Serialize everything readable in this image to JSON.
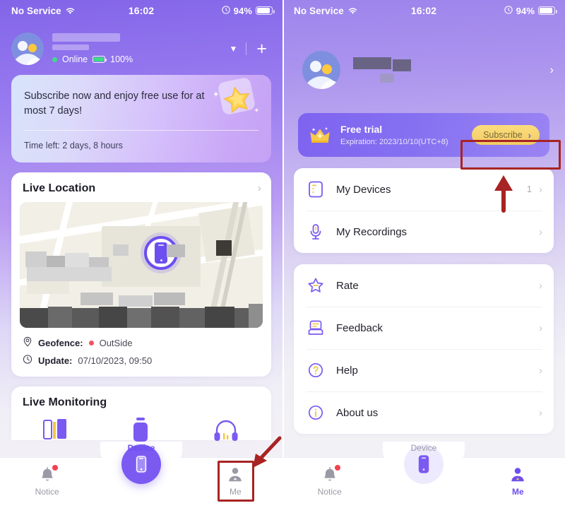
{
  "status_bar": {
    "carrier": "No Service",
    "time": "16:02",
    "battery_pct": "94%",
    "wifi_icon": "wifi-icon",
    "alarm_icon": "alarm-icon",
    "battery_icon": "battery-icon"
  },
  "left_screen": {
    "profile": {
      "avatar_icon": "user-avatar-icon",
      "name_masked": "",
      "status_text": "Online",
      "device_battery": "100%",
      "caret_icon": "chevron-down-icon",
      "add_icon": "plus-icon"
    },
    "subscribe_banner": {
      "title": "Subscribe now and enjoy free use for at most 7 days!",
      "time_left": "Time left: 2 days, 8 hours",
      "decoration_icon": "star-badge-icon"
    },
    "live_location": {
      "title": "Live Location",
      "chevron_icon": "chevron-right-icon",
      "map_pin_icon": "phone-map-pin-icon",
      "geofence_label": "Geofence:",
      "geofence_value": "OutSide",
      "geofence_icon": "location-pin-icon",
      "geofence_status_color": "#f0535f",
      "update_label": "Update:",
      "update_value": "07/10/2023, 09:50",
      "update_icon": "clock-icon"
    },
    "live_monitoring": {
      "title": "Live Monitoring",
      "icons": [
        "books-icon",
        "phone-icon",
        "headphones-icon"
      ]
    },
    "tabbar": {
      "items": [
        {
          "label": "Notice",
          "icon": "bell-icon",
          "active": false,
          "badge": true
        },
        {
          "label": "Device",
          "icon": "phone-icon",
          "active": true,
          "badge": false
        },
        {
          "label": "Me",
          "icon": "person-icon",
          "active": false,
          "badge": false
        }
      ]
    }
  },
  "right_screen": {
    "profile": {
      "avatar_icon": "user-avatar-icon",
      "name_masked": "",
      "chevron_icon": "chevron-right-icon"
    },
    "trial_card": {
      "crown_icon": "crown-icon",
      "title": "Free trial",
      "expiration": "Expiration: 2023/10/10(UTC+8)",
      "subscribe_label": "Subscribe",
      "subscribe_chevron": "chevron-right-icon",
      "button_color": "#f4cf66"
    },
    "menu_group_1": [
      {
        "label": "My Devices",
        "icon": "device-tablet-icon",
        "count": "1",
        "chevron": "chevron-right-icon"
      },
      {
        "label": "My Recordings",
        "icon": "microphone-icon",
        "count": "",
        "chevron": "chevron-right-icon"
      }
    ],
    "menu_group_2": [
      {
        "label": "Rate",
        "icon": "star-icon",
        "count": "",
        "chevron": "chevron-right-icon"
      },
      {
        "label": "Feedback",
        "icon": "inbox-icon",
        "count": "",
        "chevron": "chevron-right-icon"
      },
      {
        "label": "Help",
        "icon": "question-circle-icon",
        "count": "",
        "chevron": "chevron-right-icon"
      },
      {
        "label": "About us",
        "icon": "info-circle-icon",
        "count": "",
        "chevron": "chevron-right-icon"
      }
    ],
    "tabbar": {
      "items": [
        {
          "label": "Notice",
          "icon": "bell-icon",
          "active": false,
          "badge": true
        },
        {
          "label": "Device",
          "icon": "phone-icon",
          "active": false,
          "badge": false
        },
        {
          "label": "Me",
          "icon": "person-icon",
          "active": true,
          "badge": false
        }
      ]
    }
  },
  "annotations": {
    "highlight_color": "#a82323",
    "arrow_color": "#a82323",
    "boxes": [
      "me-tab-highlight",
      "subscribe-button-highlight"
    ],
    "arrows": [
      "arrow-to-me-tab",
      "arrow-to-subscribe-button"
    ]
  }
}
